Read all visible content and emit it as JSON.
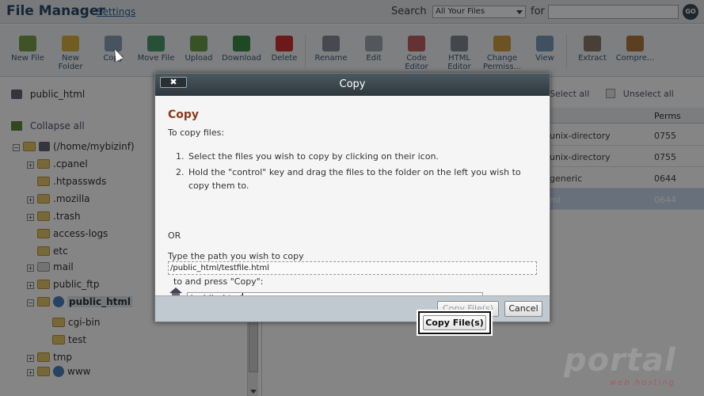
{
  "header": {
    "app_title": "File Manager",
    "settings_link": "Settings",
    "search_label": "Search",
    "search_scope": "All Your Files",
    "for_label": "for",
    "search_value": "",
    "go_label": "GO"
  },
  "toolbar": {
    "items": [
      {
        "label": "New File",
        "icon": "new-file-icon",
        "color": "#7aa04a"
      },
      {
        "label": "New Folder",
        "icon": "new-folder-icon",
        "color": "#d8b040"
      },
      {
        "label": "Copy",
        "icon": "copy-icon",
        "color": "#8aa0b8"
      },
      {
        "label": "Move File",
        "icon": "move-file-icon",
        "color": "#4a9a6a"
      },
      {
        "label": "Upload",
        "icon": "upload-icon",
        "color": "#6aa04a"
      },
      {
        "label": "Download",
        "icon": "download-icon",
        "color": "#3a8a4a"
      },
      {
        "label": "Delete",
        "icon": "delete-icon",
        "color": "#d03030"
      },
      {
        "label": "Rename",
        "icon": "rename-icon",
        "color": "#8a8a9a"
      },
      {
        "label": "Edit",
        "icon": "edit-icon",
        "color": "#a0a8b0"
      },
      {
        "label": "Code Editor",
        "icon": "code-editor-icon",
        "color": "#c06060"
      },
      {
        "label": "HTML Editor",
        "icon": "html-editor-icon",
        "color": "#808890"
      },
      {
        "label": "Change Permiss...",
        "icon": "key-icon",
        "color": "#d0a040"
      },
      {
        "label": "View",
        "icon": "view-icon",
        "color": "#7a9ab8"
      },
      {
        "label": "Extract",
        "icon": "extract-icon",
        "color": "#8a7a6a"
      },
      {
        "label": "Compre...",
        "icon": "compress-icon",
        "color": "#b07a40"
      }
    ]
  },
  "left": {
    "current_path": "public_html",
    "collapse_all": "Collapse all",
    "tree": {
      "root": "(/home/mybizinf)",
      "items": [
        ".cpanel",
        ".htpasswds",
        ".mozilla",
        ".trash",
        "access-logs",
        "etc",
        "mail",
        "public_ftp",
        "public_html",
        "cgi-bin",
        "test",
        "tmp",
        "www"
      ]
    }
  },
  "right": {
    "select_all": "Select all",
    "unselect_all": "Unselect all",
    "perms_header": "Perms",
    "rows": [
      {
        "type": "unix-directory",
        "perms": "0755"
      },
      {
        "type": "unix-directory",
        "perms": "0755"
      },
      {
        "type": "generic",
        "perms": "0644"
      },
      {
        "type": "ml",
        "perms": "0644"
      }
    ]
  },
  "dialog": {
    "title": "Copy",
    "close_label": "✖",
    "heading": "Copy",
    "intro": "To copy files:",
    "step1_num": "1.",
    "step1": "Select the files you wish to copy by clicking on their icon.",
    "step2_num": "2.",
    "step2": "Hold the \"control\" key and drag the files to the folder on the left you wish to copy them to.",
    "or_label": "OR",
    "type_label": "Type the path you wish to copy",
    "source_path": "/public_html/testfile.html",
    "press_label": "to and press \"Copy\":",
    "dest_value": "/public_html",
    "copy_button": "Copy File(s)",
    "cancel_button": "Cancel"
  },
  "callout": {
    "label": "Copy File(s)"
  },
  "watermark": {
    "brand": "portal",
    "sub": "web hosting"
  }
}
